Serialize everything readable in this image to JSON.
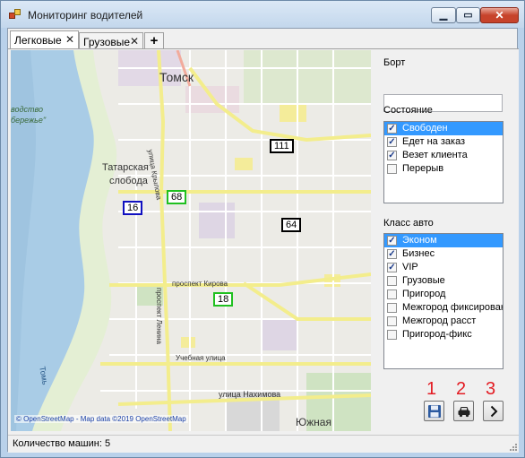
{
  "window": {
    "title": "Мониторинг водителей"
  },
  "tabs": [
    {
      "label": "Легковые",
      "close": "✕"
    },
    {
      "label": "Грузовые",
      "close": "✕"
    },
    {
      "label": "+"
    }
  ],
  "map": {
    "copyright": "© OpenStreetMap - Map data ©2019 OpenStreetMap",
    "labels": {
      "tomsk": "Томск",
      "tatar_1": "Татарская",
      "tatar_2": "слобода",
      "park_1": "водство",
      "park_2": "бережье\"",
      "krylova": "улица Крылова",
      "kirova": "проспект Кирова",
      "lenina": "проспект Ленина",
      "uchebnaya": "Учебная улица",
      "nakhimova": "улица Нахимова",
      "yuzhnaya": "Южная",
      "tom": "Томь"
    },
    "markers": [
      {
        "id": "111",
        "color": "#000000"
      },
      {
        "id": "68",
        "color": "#20c020"
      },
      {
        "id": "16",
        "color": "#1010c0"
      },
      {
        "id": "64",
        "color": "#000000"
      },
      {
        "id": "18",
        "color": "#20c020"
      }
    ]
  },
  "side": {
    "bort_label": "Борт",
    "bort_value": "",
    "state_label": "Состояние",
    "states": [
      {
        "label": "Свободен",
        "checked": true,
        "selected": true
      },
      {
        "label": "Едет на заказ",
        "checked": true,
        "selected": false
      },
      {
        "label": "Везет клиента",
        "checked": true,
        "selected": false
      },
      {
        "label": "Перерыв",
        "checked": false,
        "selected": false
      }
    ],
    "class_label": "Класс авто",
    "classes": [
      {
        "label": "Эконом",
        "checked": true,
        "selected": true
      },
      {
        "label": "Бизнес",
        "checked": true,
        "selected": false
      },
      {
        "label": "VIP",
        "checked": true,
        "selected": false
      },
      {
        "label": "Грузовые",
        "checked": false,
        "selected": false
      },
      {
        "label": "Пригород",
        "checked": false,
        "selected": false
      },
      {
        "label": "Межгород фиксировани",
        "checked": false,
        "selected": false
      },
      {
        "label": "Межгород расст",
        "checked": false,
        "selected": false
      },
      {
        "label": "Пригород-фикс",
        "checked": false,
        "selected": false
      }
    ],
    "numbers": [
      "1",
      "2",
      "3"
    ],
    "buttons": {
      "save_icon": "floppy-disk-icon",
      "car_icon": "car-icon",
      "next_icon": "chevron-right-icon"
    }
  },
  "status": {
    "text": "Количество машин: 5"
  }
}
